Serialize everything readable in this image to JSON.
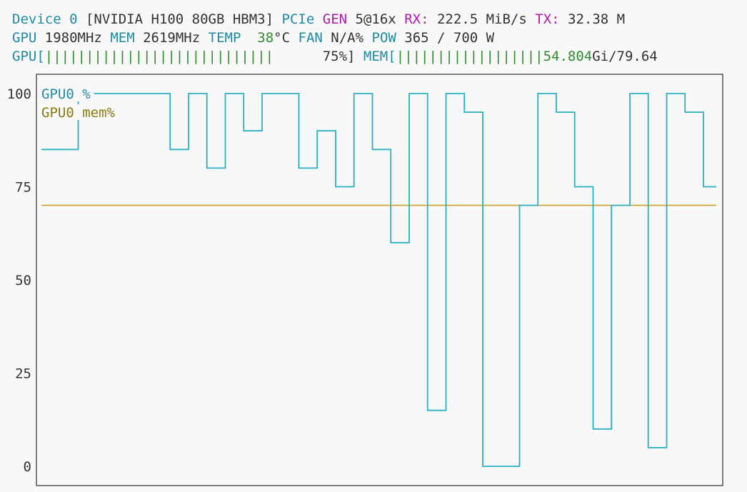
{
  "header": {
    "device_label": "Device 0",
    "device_name": "[NVIDIA H100 80GB HBM3]",
    "pcie_label": "PCIe",
    "gen_label": "GEN",
    "gen_value": "5@16x",
    "rx_label": "RX:",
    "rx_value": "222.5 MiB/s",
    "tx_label": "TX:",
    "tx_value": "32.38 M",
    "gpu_clock_label": "GPU",
    "gpu_clock_value": "1980MHz",
    "mem_clock_label": "MEM",
    "mem_clock_value": "2619MHz",
    "temp_label": "TEMP",
    "temp_value": "38",
    "temp_unit": "°C",
    "fan_label": "FAN",
    "fan_value": "N/A%",
    "pow_label": "POW",
    "pow_value": "365 / 700 W",
    "gpu_bar_label": "GPU[",
    "gpu_bar_fill": "||||||||||||||||||||||||||||",
    "gpu_bar_pct": "75%]",
    "gpu_util_fraction": 0.75,
    "mem_bar_label": "MEM[",
    "mem_bar_fill": "||||||||||||||||||",
    "mem_bar_used": "54.804",
    "mem_bar_total": "Gi/79.64",
    "mem_util_fraction": 0.688
  },
  "colors": {
    "teal": "#1f8ba3",
    "magenta": "#b21aa8",
    "green": "#2e8b2e",
    "gpu_line": "#2ab0c0",
    "mem_line": "#c9a227",
    "mem_legend": "#8a7a10"
  },
  "chart_data": {
    "type": "line",
    "step": true,
    "y_ticks": [
      "100",
      "75",
      "50",
      "25",
      "0"
    ],
    "ylim": [
      0,
      100
    ],
    "legend_position": "top-left",
    "series": [
      {
        "name": "GPU0 %",
        "values": [
          85,
          85,
          100,
          100,
          100,
          100,
          100,
          85,
          100,
          80,
          100,
          90,
          100,
          100,
          80,
          90,
          75,
          100,
          85,
          60,
          100,
          15,
          100,
          95,
          0,
          0,
          70,
          100,
          95,
          75,
          10,
          70,
          100,
          5,
          100,
          95,
          75
        ]
      },
      {
        "name": "GPU0 mem%",
        "values": [
          70,
          70,
          70,
          70,
          70,
          70,
          70,
          70,
          70,
          70,
          70,
          70,
          70,
          70,
          70,
          70,
          70,
          70,
          70,
          70,
          70,
          70,
          70,
          70,
          70,
          70,
          70,
          70,
          70,
          70,
          70,
          70,
          70,
          70,
          70,
          70,
          70
        ]
      }
    ]
  }
}
